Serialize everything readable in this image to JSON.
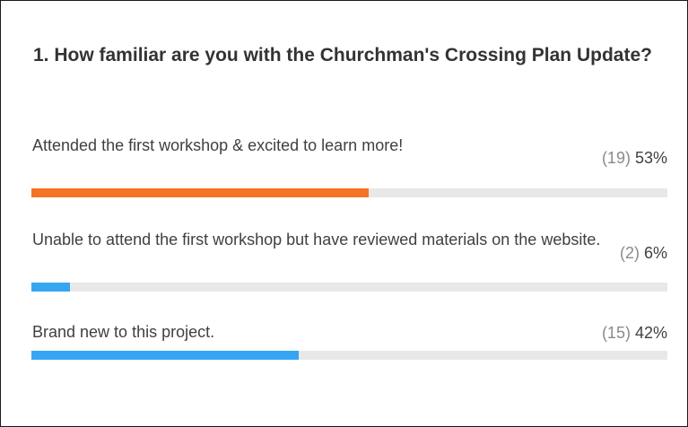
{
  "question": {
    "title": "1. How familiar are you with the Churchman's Crossing Plan Update?"
  },
  "options": [
    {
      "label": "Attended the first workshop & excited to learn more!",
      "count_text": "(19)",
      "percent_text": "53%",
      "fraction": 0.53,
      "color": "#f47324"
    },
    {
      "label": "Unable to attend the first workshop but have reviewed materials on the website.",
      "count_text": "(2)",
      "percent_text": "6%",
      "fraction": 0.06,
      "color": "#36a6f2"
    },
    {
      "label": "Brand new to this project.",
      "count_text": "(15)",
      "percent_text": "42%",
      "fraction": 0.42,
      "color": "#36a6f2"
    }
  ],
  "colors": {
    "track": "#e8e8e8",
    "text": "#404040",
    "count": "#8a8a8a"
  }
}
